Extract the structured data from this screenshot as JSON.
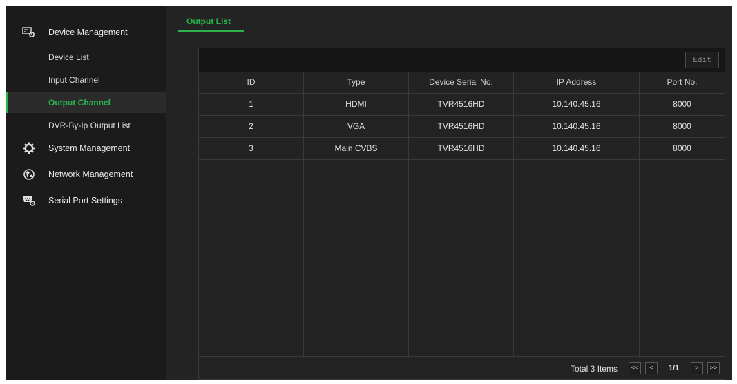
{
  "sidebar": {
    "groups": [
      {
        "label": "Device Management",
        "icon": "device-management-icon"
      },
      {
        "label": "System Management",
        "icon": "gear-icon"
      },
      {
        "label": "Network Management",
        "icon": "globe-icon"
      },
      {
        "label": "Serial Port Settings",
        "icon": "serial-port-icon"
      }
    ],
    "device_items": [
      {
        "label": "Device List"
      },
      {
        "label": "Input Channel"
      },
      {
        "label": "Output Channel",
        "active": true
      },
      {
        "label": "DVR-By-Ip Output List"
      }
    ]
  },
  "tabs": [
    {
      "label": "Output List",
      "active": true
    }
  ],
  "toolbar": {
    "edit_label": "Edit"
  },
  "table": {
    "columns": [
      "ID",
      "Type",
      "Device Serial No.",
      "IP Address",
      "Port No."
    ],
    "rows": [
      [
        "1",
        "HDMI",
        "TVR4516HD",
        "10.140.45.16",
        "8000"
      ],
      [
        "2",
        "VGA",
        "TVR4516HD",
        "10.140.45.16",
        "8000"
      ],
      [
        "3",
        "Main CVBS",
        "TVR4516HD",
        "10.140.45.16",
        "8000"
      ]
    ]
  },
  "pagination": {
    "total_text": "Total 3 Items",
    "first": "<<",
    "prev": "<",
    "page": "1/1",
    "next": ">",
    "last": ">>"
  },
  "colors": {
    "accent": "#2cb24a",
    "background": "#232323",
    "sidebar": "#1b1b1b"
  }
}
